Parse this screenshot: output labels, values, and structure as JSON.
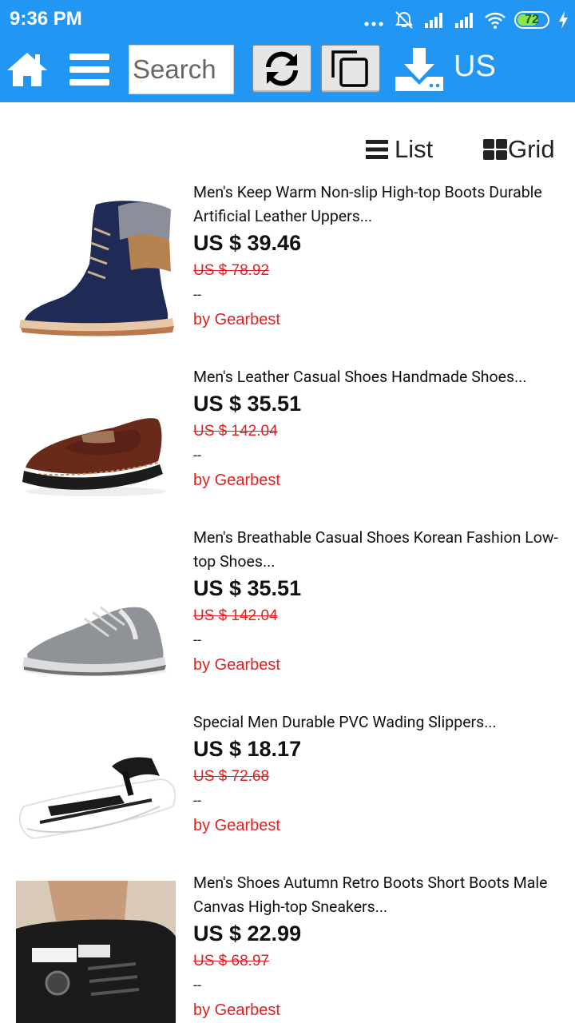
{
  "status_bar": {
    "time": "9:36 PM",
    "battery_level": "72",
    "icons": [
      "more-dots-icon",
      "alarm-off-icon",
      "signal-icon",
      "signal-icon",
      "wifi-icon",
      "battery-icon",
      "charging-icon"
    ]
  },
  "toolbar": {
    "search_placeholder": "Search",
    "region": "US",
    "icons": [
      "home-icon",
      "menu-icon",
      "refresh-icon",
      "copy-icon",
      "download-icon"
    ]
  },
  "view": {
    "list_label": "List",
    "grid_label": "Grid"
  },
  "products": [
    {
      "title": "Men's Keep Warm Non-slip High-top Boots Durable Artificial Leather Uppers...",
      "price": "US $ 39.46",
      "old_price": "US $ 78.92",
      "dash": "--",
      "seller": "by Gearbest"
    },
    {
      "title": "Men's Leather Casual Shoes Handmade Shoes...",
      "price": "US $ 35.51",
      "old_price": "US $ 142.04",
      "dash": "--",
      "seller": "by Gearbest"
    },
    {
      "title": "Men's Breathable Casual Shoes Korean Fashion Low-top Shoes...",
      "price": "US $ 35.51",
      "old_price": "US $ 142.04",
      "dash": "--",
      "seller": "by Gearbest"
    },
    {
      "title": "Special Men Durable PVC Wading Slippers...",
      "price": "US $ 18.17",
      "old_price": "US $ 72.68",
      "dash": "--",
      "seller": "by Gearbest"
    },
    {
      "title": "Men's Shoes Autumn Retro Boots Short Boots Male Canvas High-top Sneakers...",
      "price": "US $ 22.99",
      "old_price": "US $ 68.97",
      "dash": "--",
      "seller": "by Gearbest"
    }
  ],
  "colors": {
    "primary": "#2196f3",
    "price_sale": "#e02020"
  }
}
